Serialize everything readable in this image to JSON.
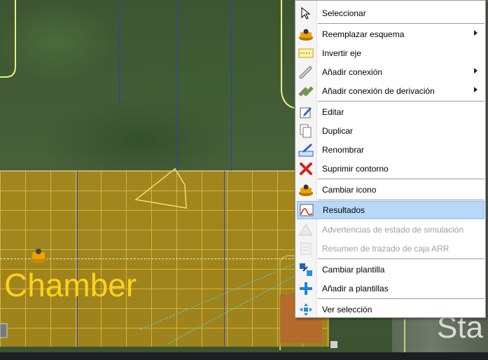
{
  "canvas": {
    "labels": {
      "chamber": "Chamber",
      "sta": "Sta"
    },
    "colors": {
      "zone": "#c49614",
      "grid": "#f0be46",
      "pipe": "#2c3fb8",
      "dash": "#4fd3d6",
      "label": "#ffd21a"
    }
  },
  "menu": {
    "items": [
      {
        "label": "Seleccionar",
        "icon": "cursor-arrow-icon"
      },
      {
        "label": "Reemplazar esquema",
        "icon": "pump-icon",
        "submenu": true
      },
      {
        "label": "Invertir eje",
        "icon": "reverse-axis-icon"
      },
      {
        "label": "Añadir conexión",
        "icon": "pipe-connection-icon",
        "submenu": true
      },
      {
        "label": "Añadir conexión de derivación",
        "icon": "branch-connection-icon",
        "submenu": true
      },
      {
        "label": "Editar",
        "icon": "edit-pencil-icon"
      },
      {
        "label": "Duplicar",
        "icon": "duplicate-pages-icon"
      },
      {
        "label": "Renombrar",
        "icon": "rename-icon"
      },
      {
        "label": "Suprimir contorno",
        "icon": "delete-x-icon"
      },
      {
        "label": "Cambiar icono",
        "icon": "pump-icon"
      },
      {
        "label": "Resultados",
        "icon": "results-chart-icon",
        "highlighted": true
      },
      {
        "label": "Advertencias de estado de simulación",
        "icon": "warning-icon",
        "disabled": true
      },
      {
        "label": "Resumen de trazado de caja ARR",
        "icon": "arr-summary-icon",
        "disabled": true
      },
      {
        "label": "Cambiar plantilla",
        "icon": "change-template-icon"
      },
      {
        "label": "Añadir a plantillas",
        "icon": "add-template-icon"
      },
      {
        "label": "Ver selección",
        "icon": "view-selection-icon"
      }
    ]
  }
}
